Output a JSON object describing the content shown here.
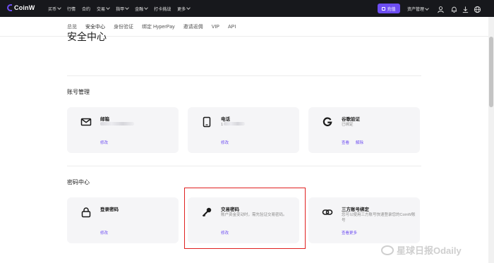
{
  "topbar": {
    "logo": "CoinW",
    "nav": [
      {
        "label": "买币",
        "caret": true
      },
      {
        "label": "行情",
        "caret": false
      },
      {
        "label": "合约",
        "caret": false
      },
      {
        "label": "交易",
        "caret": true
      },
      {
        "label": "指甲",
        "caret": true
      },
      {
        "label": "金融",
        "caret": true
      },
      {
        "label": "打卡挑战",
        "caret": false
      },
      {
        "label": "更多",
        "caret": true
      }
    ],
    "recharge_label": "充值",
    "assets_label": "资产管理",
    "icons": [
      "user-icon",
      "bell-icon",
      "download-icon",
      "globe-icon"
    ],
    "accent": "#6d4df2",
    "bg": "#17181c"
  },
  "subnav": [
    "总览",
    "安全中心",
    "身份验证",
    "绑定 HyperPay",
    "邀请返佣",
    "VIP",
    "API"
  ],
  "page_title": "安全中心",
  "account_section": {
    "title": "账号管理",
    "cards": [
      {
        "icon": "mail-icon",
        "title": "邮箱",
        "links": [
          "修改"
        ]
      },
      {
        "icon": "phone-icon",
        "title": "电话",
        "value_prefix": "1",
        "links": [
          "修改"
        ]
      },
      {
        "icon": "google-icon",
        "title": "谷歌验证",
        "status": "已绑定",
        "links": [
          "查看",
          "解除"
        ]
      }
    ]
  },
  "password_section": {
    "title": "密码中心",
    "cards": [
      {
        "icon": "lock-icon",
        "title": "登录密码",
        "links": [
          "修改"
        ]
      },
      {
        "icon": "key-icon",
        "title": "交易密码",
        "desc": "账户资金变动时，需先验证交易密码。",
        "links": [
          "修改"
        ]
      },
      {
        "icon": "link-icon",
        "title": "三方账号绑定",
        "desc": "您可以使用三方账号快速登录您的CoinW账号",
        "links": [
          "查看更多"
        ]
      }
    ]
  },
  "watermark": "星球日报Odaily"
}
